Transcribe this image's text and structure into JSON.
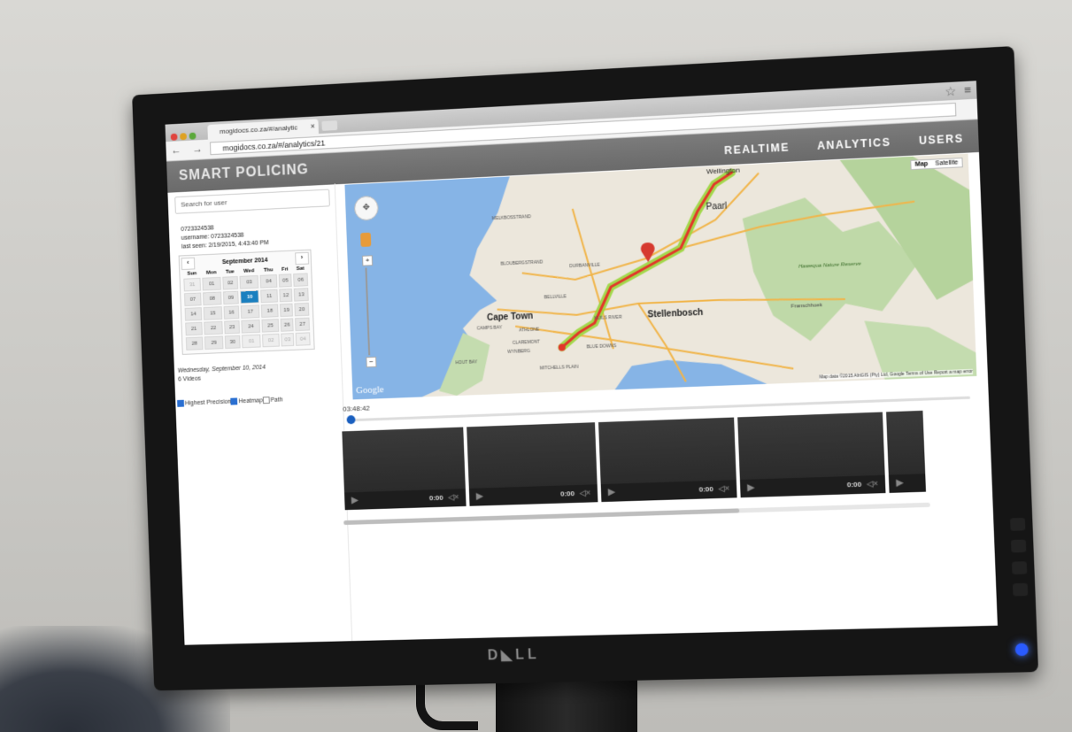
{
  "browser": {
    "tab_title": "mogidocs.co.za/#/analytic",
    "tab_close": "×",
    "url": "mogidocs.co.za/#/analytics/21",
    "nav": "← → C",
    "star": "☆",
    "menu": "≡"
  },
  "app": {
    "title": "SMART POLICING",
    "nav": [
      "REALTIME",
      "ANALYTICS",
      "USERS"
    ]
  },
  "sidebar": {
    "search_placeholder": "Search for user",
    "user_phone": "0723324538",
    "username": "username: 0723324538",
    "last_seen": "last seen: 2/19/2015, 4:43:40 PM",
    "calendar": {
      "month": "September 2014",
      "prev": "‹",
      "next": "›",
      "weekdays": [
        "Sun",
        "Mon",
        "Tue",
        "Wed",
        "Thu",
        "Fri",
        "Sat"
      ],
      "weeks": [
        [
          "31",
          "01",
          "02",
          "03",
          "04",
          "05",
          "06"
        ],
        [
          "07",
          "08",
          "09",
          "10",
          "11",
          "12",
          "13"
        ],
        [
          "14",
          "15",
          "16",
          "17",
          "18",
          "19",
          "20"
        ],
        [
          "21",
          "22",
          "23",
          "24",
          "25",
          "26",
          "27"
        ],
        [
          "28",
          "29",
          "30",
          "01",
          "02",
          "03",
          "04"
        ]
      ],
      "selected": "10"
    },
    "selected_date": "Wednesday, September 10, 2014",
    "video_count": "6 Videos",
    "options": {
      "highest_precision": "Highest Precision",
      "heatmap": "Heatmap",
      "path": "Path"
    }
  },
  "map": {
    "type_map": "Map",
    "type_satellite": "Satellite",
    "labels": {
      "wellington": "Wellington",
      "paarl": "Paarl",
      "stellenbosch": "Stellenbosch",
      "cape_town": "Cape Town",
      "durbanville": "DURBANVILLE",
      "bellville": "BELLVILLE",
      "melkbosstrand": "MELKBOSSTRAND",
      "blouberg": "BLOUBERGSTRAND",
      "hawequa": "Hawequa Nature Reserve",
      "franschhoek": "Franschhoek",
      "kuils_river": "KUILS RIVER",
      "blue_downs": "BLUE DOWNS",
      "mitchells_plain": "MITCHELLS PLAIN",
      "hout_bay": "HOUT BAY",
      "athlone": "ATHLONE",
      "camps_bay": "CAMPS BAY",
      "claremont": "CLAREMONT",
      "wynberg": "WYNBERG"
    },
    "google": "Google",
    "attribution": "Map data ©2015 AfriGIS (Pty) Ltd, Google   Terms of Use   Report a map error"
  },
  "timeline": {
    "time": "03:48:42",
    "position": 0.0
  },
  "videos": [
    {
      "time": "0:00"
    },
    {
      "time": "0:00"
    },
    {
      "time": "0:00"
    },
    {
      "time": "0:00"
    },
    {
      "time": ""
    }
  ],
  "colors": {
    "header": "#6e6e6e",
    "selected_day": "#1a7fbf",
    "route": "#9bd63c",
    "heat": "#e2362a",
    "water": "#7fb3e8"
  }
}
